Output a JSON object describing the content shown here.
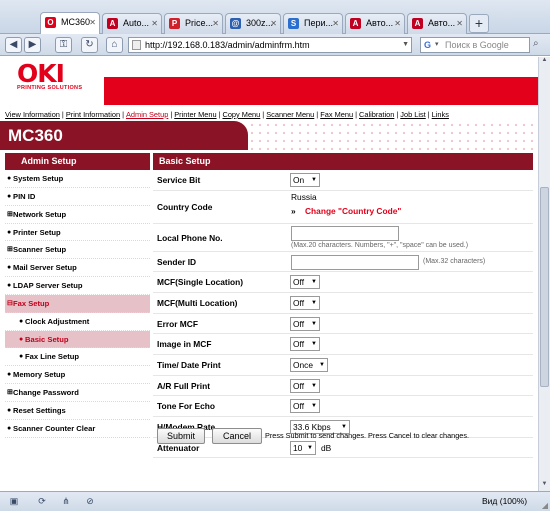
{
  "browser": {
    "tabs": [
      {
        "label": "MC360",
        "fav": "O",
        "fav_color": "#e2001a",
        "active": true
      },
      {
        "label": "Auto...",
        "fav": "A",
        "fav_color": "#c00020",
        "active": false
      },
      {
        "label": "Price...",
        "fav": "P",
        "fav_color": "#d0202a",
        "active": false
      },
      {
        "label": "300z...",
        "fav": "@",
        "fav_color": "#2b5fb0",
        "active": false
      },
      {
        "label": "Пери...",
        "fav": "S",
        "fav_color": "#2a6fd0",
        "active": false
      },
      {
        "label": "Авто...",
        "fav": "A",
        "fav_color": "#c00020",
        "active": false
      },
      {
        "label": "Авто...",
        "fav": "A",
        "fav_color": "#c00020",
        "active": false
      }
    ],
    "new_tab": "+",
    "url": "http://192.168.0.183/admin/adminfrm.htm",
    "search_placeholder": "Поиск в Google",
    "zoom": "Вид (100%)"
  },
  "header": {
    "logo": "OKI",
    "logo_sub": "PRINTING SOLUTIONS",
    "model": "MC360",
    "brand_color": "#e2001a",
    "accent_color": "#8a1426"
  },
  "topnav": [
    {
      "label": "View Information",
      "current": false
    },
    {
      "label": "Print Information",
      "current": false
    },
    {
      "label": "Admin Setup",
      "current": true
    },
    {
      "label": "Printer Menu",
      "current": false
    },
    {
      "label": "Copy Menu",
      "current": false
    },
    {
      "label": "Scanner Menu",
      "current": false
    },
    {
      "label": "Fax Menu",
      "current": false
    },
    {
      "label": "Calibration",
      "current": false
    },
    {
      "label": "Job List",
      "current": false
    },
    {
      "label": "Links",
      "current": false
    }
  ],
  "sidebar": {
    "title": "Admin Setup",
    "items": [
      {
        "label": "System Setup",
        "mark": "●",
        "sub": false,
        "selected": false
      },
      {
        "label": "PIN ID",
        "mark": "●",
        "sub": false,
        "selected": false
      },
      {
        "label": "Network Setup",
        "mark": "⊞",
        "sub": false,
        "selected": false
      },
      {
        "label": "Printer Setup",
        "mark": "●",
        "sub": false,
        "selected": false
      },
      {
        "label": "Scanner Setup",
        "mark": "⊞",
        "sub": false,
        "selected": false
      },
      {
        "label": "Mail Server Setup",
        "mark": "●",
        "sub": false,
        "selected": false
      },
      {
        "label": "LDAP Server Setup",
        "mark": "●",
        "sub": false,
        "selected": false
      },
      {
        "label": "Fax Setup",
        "mark": "⊟",
        "sub": false,
        "selected": true
      },
      {
        "label": "Clock Adjustment",
        "mark": "●",
        "sub": true,
        "selected": false
      },
      {
        "label": "Basic Setup",
        "mark": "●",
        "sub": true,
        "selected": true
      },
      {
        "label": "Fax Line Setup",
        "mark": "●",
        "sub": true,
        "selected": false
      },
      {
        "label": "Memory Setup",
        "mark": "●",
        "sub": false,
        "selected": false
      },
      {
        "label": "Change Password",
        "mark": "⊞",
        "sub": false,
        "selected": false
      },
      {
        "label": "Reset Settings",
        "mark": "●",
        "sub": false,
        "selected": false
      },
      {
        "label": "Scanner Counter Clear",
        "mark": "●",
        "sub": false,
        "selected": false
      }
    ]
  },
  "main": {
    "title": "Basic Setup",
    "service_bit": {
      "label": "Service Bit",
      "value": "On"
    },
    "country_code": {
      "label": "Country Code",
      "value": "Russia",
      "link_prefix": "»",
      "link": "Change \"Country Code\""
    },
    "local_phone": {
      "label": "Local Phone No.",
      "value": "",
      "hint": "(Max.20 characters. Numbers, \"+\", \"space\" can be used.)"
    },
    "sender_id": {
      "label": "Sender ID",
      "value": "",
      "hint": "(Max.32 characters)"
    },
    "mcf_single": {
      "label": "MCF(Single Location)",
      "value": "Off"
    },
    "mcf_multi": {
      "label": "MCF(Multi Location)",
      "value": "Off"
    },
    "error_mcf": {
      "label": "Error MCF",
      "value": "Off"
    },
    "image_mcf": {
      "label": "Image in MCF",
      "value": "Off"
    },
    "time_date_print": {
      "label": "Time/ Date Print",
      "value": "Once"
    },
    "ar_full_print": {
      "label": "A/R Full Print",
      "value": "Off"
    },
    "tone_echo": {
      "label": "Tone For Echo",
      "value": "Off"
    },
    "modem_rate": {
      "label": "H/Modem Rate",
      "value": "33.6 Kbps"
    },
    "attenuator": {
      "label": "Attenuator",
      "value": "10",
      "unit": "dB"
    }
  },
  "buttons": {
    "submit": "Submit",
    "cancel": "Cancel",
    "hint": "Press Submit to send changes. Press Cancel to clear changes."
  }
}
